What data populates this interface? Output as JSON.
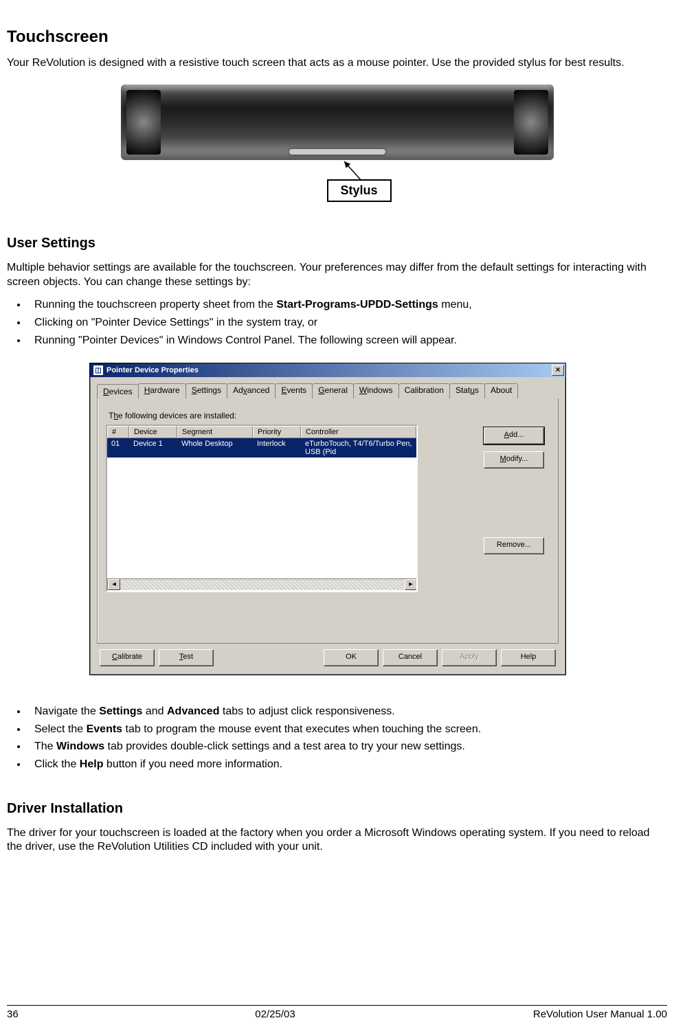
{
  "sections": {
    "touchscreen": {
      "heading": "Touchscreen",
      "p1": "Your ReVolution is designed with a resistive touch screen that acts as a mouse pointer. Use the provided stylus for best results.",
      "stylus_label": "Stylus"
    },
    "user_settings": {
      "heading": "User Settings",
      "p1": "Multiple behavior settings are available for the touchscreen. Your preferences may differ from the default settings for interacting with screen objects. You can change these settings by:",
      "bullets1": {
        "b1_pre": "Running the touchscreen property sheet from the ",
        "b1_bold": "Start-Programs-UPDD-Settings",
        "b1_post": " menu,",
        "b2": "Clicking on \"Pointer Device Settings\" in the system tray, or",
        "b3": "Running \"Pointer Devices\" in Windows Control Panel. The following screen will appear."
      },
      "bullets2": {
        "b1_pre": "Navigate the ",
        "b1_b1": "Settings",
        "b1_mid": " and ",
        "b1_b2": "Advanced",
        "b1_post": " tabs to adjust click responsiveness.",
        "b2_pre": "Select the ",
        "b2_b": "Events",
        "b2_post": " tab to program the mouse event that executes when touching the screen.",
        "b3_pre": "The ",
        "b3_b": "Windows",
        "b3_post": " tab provides double-click settings and a test area to try your new settings.",
        "b4_pre": "Click the ",
        "b4_b": "Help",
        "b4_post": " button if you need more information."
      }
    },
    "driver": {
      "heading": "Driver Installation",
      "p1": "The driver for your touchscreen is loaded at the factory when you order a Microsoft Windows operating system. If you need to reload the driver, use the ReVolution Utilities CD included with your unit."
    }
  },
  "dialog": {
    "title": "Pointer Device Properties",
    "tabs": [
      "Devices",
      "Hardware",
      "Settings",
      "Advanced",
      "Events",
      "General",
      "Windows",
      "Calibration",
      "Status",
      "About"
    ],
    "active_tab": "Devices",
    "pane_label": "The following devices are installed:",
    "columns": {
      "num": "#",
      "device": "Device",
      "segment": "Segment",
      "priority": "Priority",
      "controller": "Controller"
    },
    "row": {
      "num": "01",
      "device": "Device 1",
      "segment": "Whole Desktop",
      "priority": "Interlock",
      "controller": "eTurboTouch, T4/T6/Turbo Pen, USB (Pid"
    },
    "side_buttons": {
      "add": "Add...",
      "modify": "Modify...",
      "remove": "Remove..."
    },
    "bottom_buttons": {
      "calibrate": "Calibrate",
      "test": "Test",
      "ok": "OK",
      "cancel": "Cancel",
      "apply": "Apply",
      "help": "Help"
    }
  },
  "footer": {
    "page": "36",
    "date": "02/25/03",
    "doc": "ReVolution User Manual 1.00"
  }
}
